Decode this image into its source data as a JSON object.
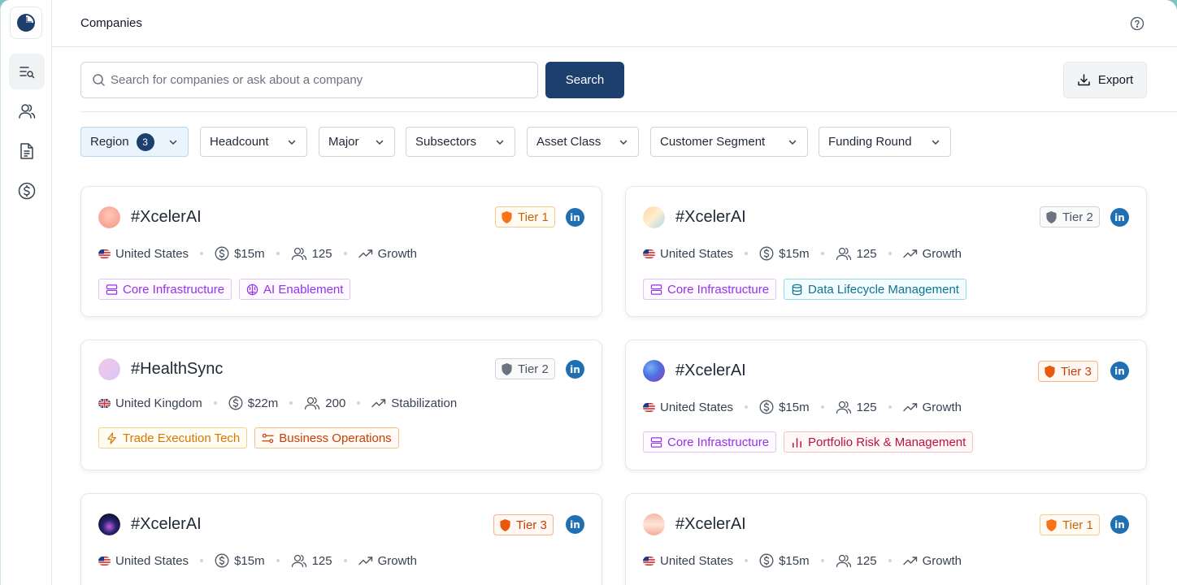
{
  "app": {
    "title": "Companies"
  },
  "search": {
    "placeholder": "Search for companies or ask about a company",
    "button_label": "Search"
  },
  "export": {
    "label": "Export"
  },
  "filters": [
    {
      "label": "Region",
      "count": "3",
      "active": true
    },
    {
      "label": "Headcount"
    },
    {
      "label": "Major"
    },
    {
      "label": "Subsectors"
    },
    {
      "label": "Asset Class"
    },
    {
      "label": "Customer Segment"
    },
    {
      "label": "Funding Round"
    }
  ],
  "colors": {
    "accent": "#1d3f6e",
    "linkedin": "#1f6fb2"
  },
  "companies": [
    {
      "name": "#XcelerAI",
      "tier": "Tier 1",
      "country": "United States",
      "funding": "$15m",
      "headcount": "125",
      "stage": "Growth",
      "tags": [
        {
          "label": "Core Infrastructure",
          "icon": "server-icon"
        },
        {
          "label": "AI Enablement",
          "icon": "brain-icon"
        }
      ]
    },
    {
      "name": "#XcelerAI",
      "tier": "Tier 2",
      "country": "United States",
      "funding": "$15m",
      "headcount": "125",
      "stage": "Growth",
      "tags": [
        {
          "label": "Core Infrastructure",
          "icon": "server-icon"
        },
        {
          "label": "Data Lifecycle Management",
          "icon": "database-icon"
        }
      ]
    },
    {
      "name": "#HealthSync",
      "tier": "Tier 2",
      "country": "United Kingdom",
      "funding": "$22m",
      "headcount": "200",
      "stage": "Stabilization",
      "tags": [
        {
          "label": "Trade Execution Tech",
          "icon": "bolt-icon"
        },
        {
          "label": "Business Operations",
          "icon": "sliders-icon"
        }
      ]
    },
    {
      "name": "#XcelerAI",
      "tier": "Tier 3",
      "country": "United States",
      "funding": "$15m",
      "headcount": "125",
      "stage": "Growth",
      "tags": [
        {
          "label": "Core Infrastructure",
          "icon": "server-icon"
        },
        {
          "label": "Portfolio Risk & Management",
          "icon": "bar-chart-icon"
        }
      ]
    },
    {
      "name": "#XcelerAI",
      "tier": "Tier 3",
      "country": "United States",
      "funding": "$15m",
      "headcount": "125",
      "stage": "Growth"
    },
    {
      "name": "#XcelerAI",
      "tier": "Tier 1",
      "country": "United States",
      "funding": "$15m",
      "headcount": "125",
      "stage": "Growth"
    }
  ],
  "linkedin_label": "in"
}
